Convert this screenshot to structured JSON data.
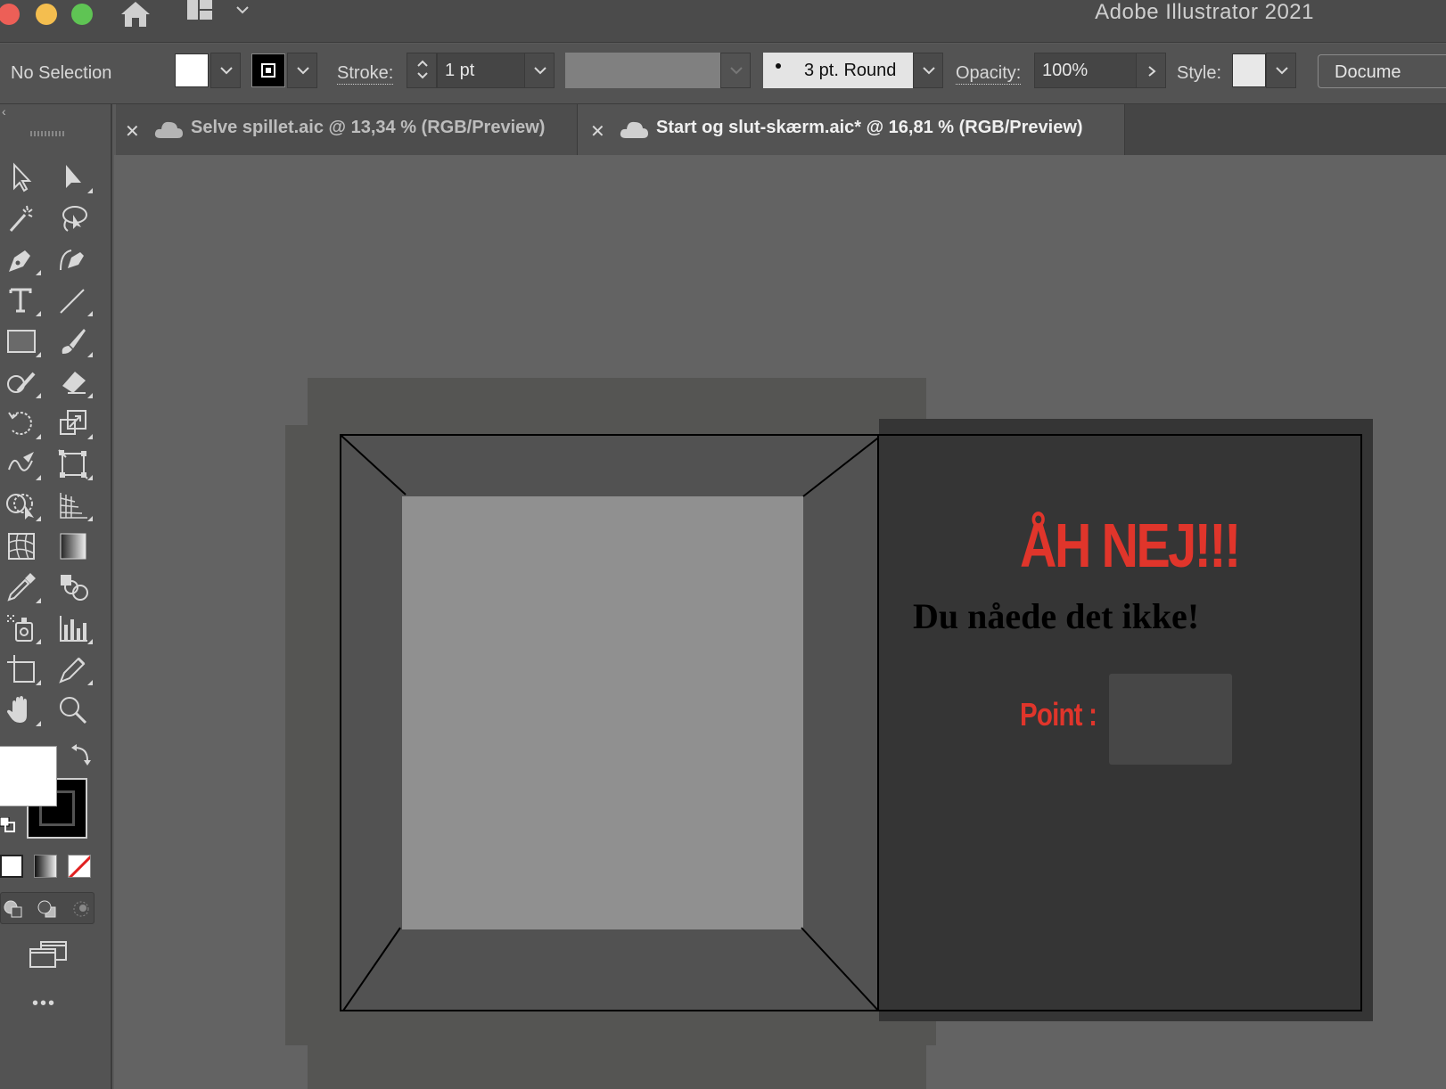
{
  "app": {
    "title": "Adobe Illustrator 2021"
  },
  "control_bar": {
    "selection_label": "No Selection",
    "stroke_label": "Stroke:",
    "stroke_value": "1 pt",
    "brush_value": "3 pt. Round",
    "opacity_label": "Opacity:",
    "opacity_value": "100%",
    "style_label": "Style:",
    "document_label": "Docume",
    "fill_color": "#ffffff",
    "stroke_color": "#000000"
  },
  "tabs": [
    {
      "label": "Selve spillet.aic @ 13,34 % (RGB/Preview)",
      "active": false
    },
    {
      "label": "Start og slut-skærm.aic* @ 16,81 % (RGB/Preview)",
      "active": true
    }
  ],
  "toolbar": {
    "tools": [
      "selection-tool",
      "direct-selection-tool",
      "magic-wand-tool",
      "lasso-tool",
      "pen-tool",
      "curvature-tool",
      "type-tool",
      "line-segment-tool",
      "rectangle-tool",
      "paintbrush-tool",
      "shaper-tool",
      "eraser-tool",
      "rotate-tool",
      "scale-tool",
      "warp-tool",
      "free-transform-tool",
      "shape-builder-tool",
      "perspective-grid-tool",
      "mesh-tool",
      "gradient-tool",
      "eyedropper-tool",
      "blend-tool",
      "symbol-sprayer-tool",
      "column-graph-tool",
      "artboard-tool",
      "slice-tool",
      "hand-tool",
      "zoom-tool"
    ],
    "more_label": "•••"
  },
  "artwork": {
    "headline": "ÅH NEJ!!!",
    "subline": "Du nåede det ikke!",
    "points_label": "Point :",
    "accent_color": "#e0352b",
    "text_color": "#000000"
  }
}
